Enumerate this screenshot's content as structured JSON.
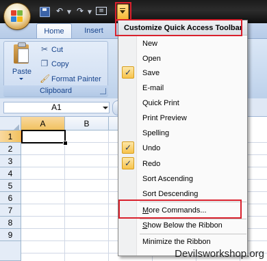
{
  "ribbon": {
    "tabs": [
      {
        "label": "Home"
      },
      {
        "label": "Insert"
      }
    ],
    "clipboard": {
      "paste_label": "Paste",
      "cut_label": "Cut",
      "copy_label": "Copy",
      "format_painter_label": "Format Painter",
      "group_label": "Clipboard"
    }
  },
  "formula_bar": {
    "name_box_value": "A1"
  },
  "grid": {
    "columns": [
      "A",
      "B"
    ],
    "rows": [
      "1",
      "2",
      "3",
      "4",
      "5",
      "6",
      "7",
      "8",
      "9"
    ],
    "selected_cell": "A1"
  },
  "qat_menu": {
    "title": "Customize Quick Access Toolbar",
    "items": [
      {
        "label": "New",
        "checked": false
      },
      {
        "label": "Open",
        "checked": false
      },
      {
        "label": "Save",
        "checked": true
      },
      {
        "label": "E-mail",
        "checked": false
      },
      {
        "label": "Quick Print",
        "checked": false
      },
      {
        "label": "Print Preview",
        "checked": false
      },
      {
        "label": "Spelling",
        "checked": false
      },
      {
        "label": "Undo",
        "checked": true
      },
      {
        "label": "Redo",
        "checked": true
      },
      {
        "label": "Sort Ascending",
        "checked": false
      },
      {
        "label": "Sort Descending",
        "checked": false
      }
    ],
    "more_commands": "More Commands...",
    "show_below": "Show Below the Ribbon",
    "minimize": "Minimize the Ribbon"
  },
  "watermark": "Devilsworkshop.org",
  "colors": {
    "highlight_box": "#d9202c",
    "checked_bg": "#f7c34c",
    "ribbon_text": "#15428b"
  }
}
